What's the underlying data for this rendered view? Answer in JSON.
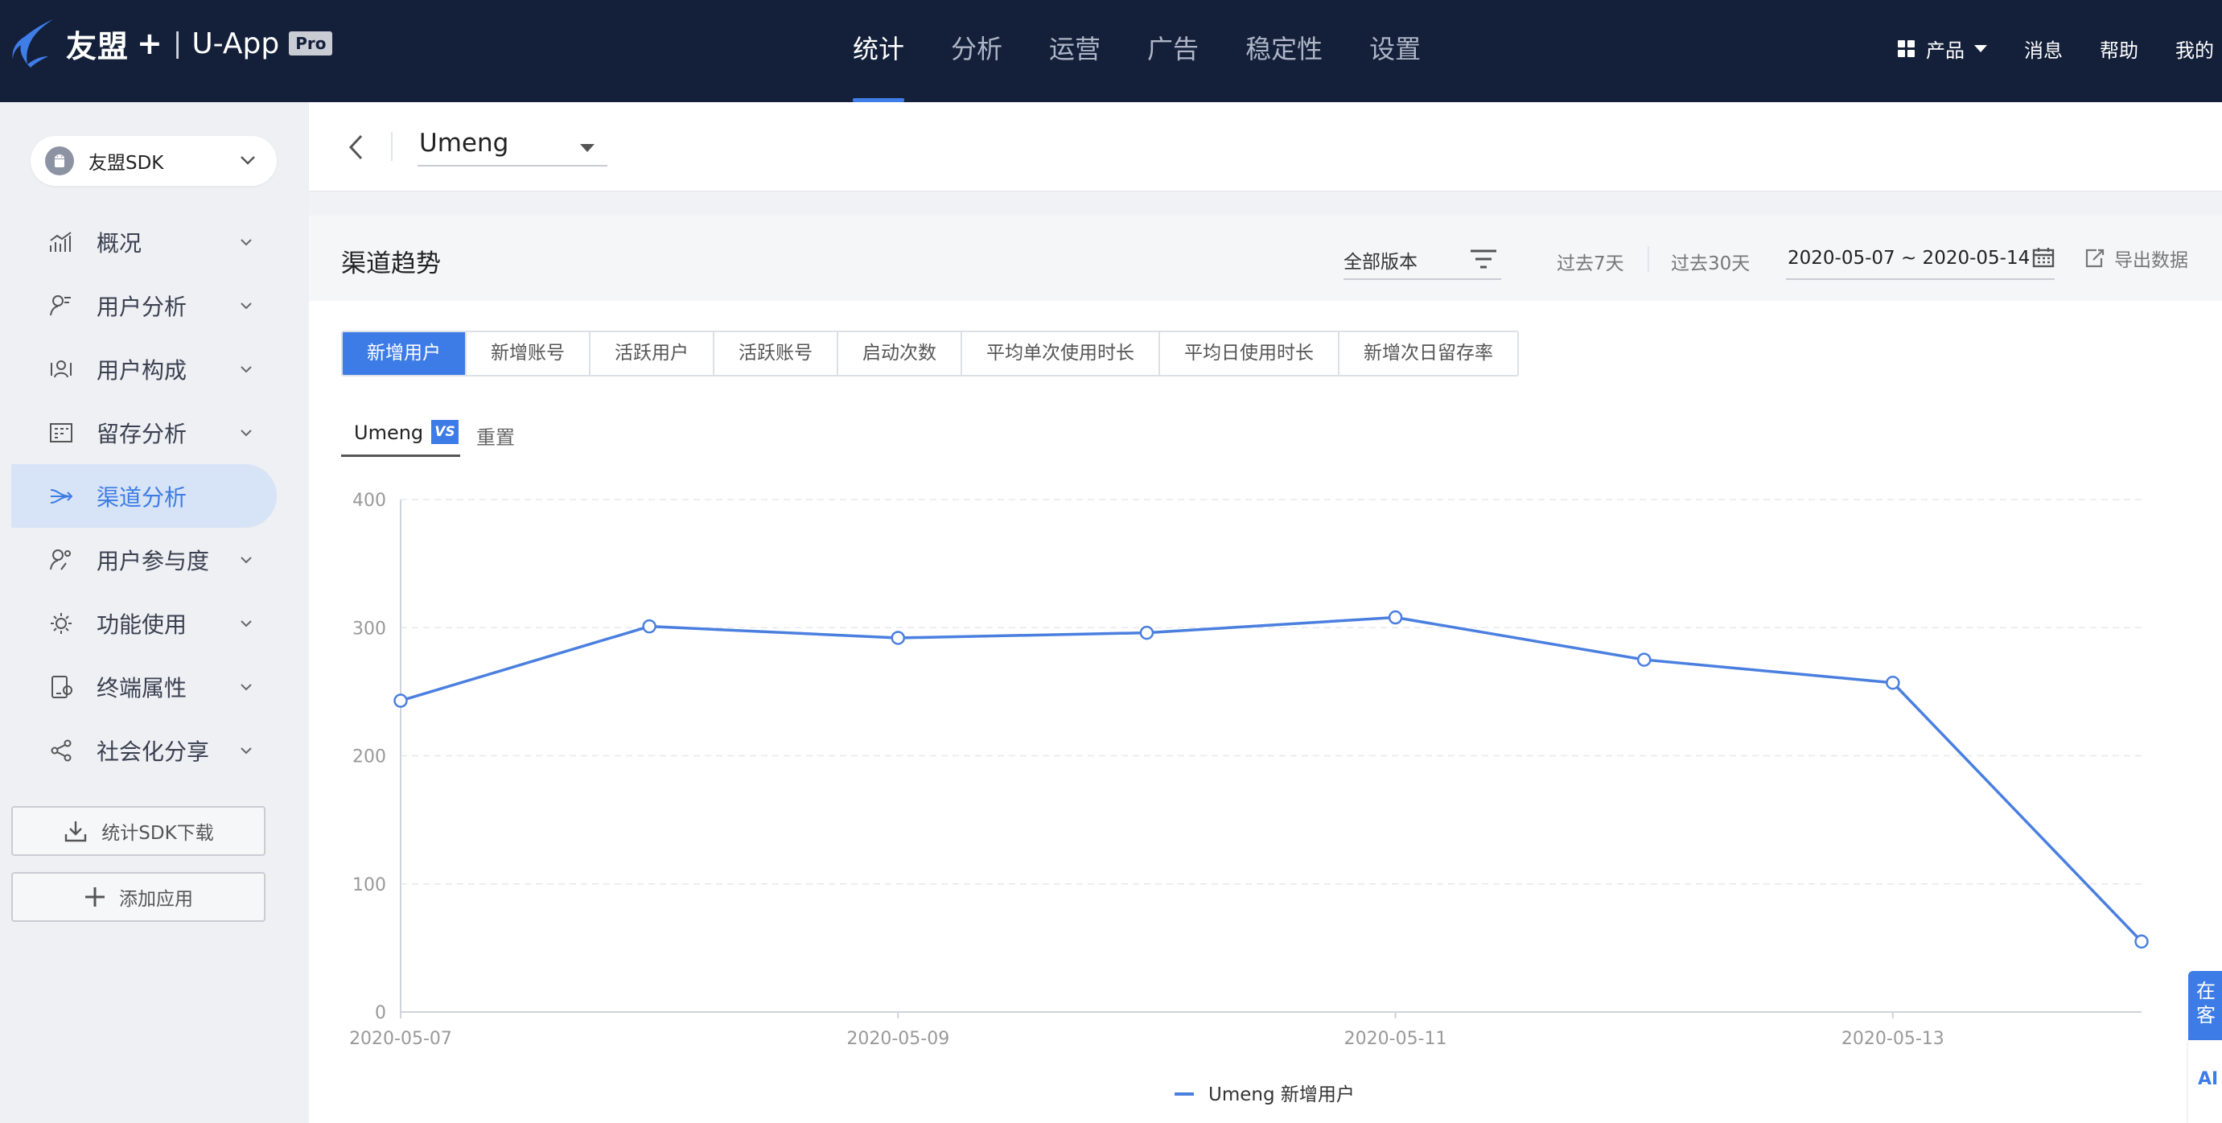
{
  "topbar": {
    "logo_text": "友盟",
    "logo_plus": "+",
    "logo_sep": "|",
    "logo_app": "U-App",
    "logo_badge": "Pro",
    "nav": [
      {
        "label": "统计",
        "active": true
      },
      {
        "label": "分析",
        "active": false
      },
      {
        "label": "运营",
        "active": false
      },
      {
        "label": "广告",
        "active": false
      },
      {
        "label": "稳定性",
        "active": false
      },
      {
        "label": "设置",
        "active": false
      }
    ],
    "right": {
      "product": "产品",
      "messages": "消息",
      "help": "帮助",
      "mine": "我的"
    }
  },
  "sidebar": {
    "app_name": "友盟SDK",
    "items": [
      {
        "label": "概况",
        "icon": "trend-icon"
      },
      {
        "label": "用户分析",
        "icon": "user-analysis-icon"
      },
      {
        "label": "用户构成",
        "icon": "user-composition-icon"
      },
      {
        "label": "留存分析",
        "icon": "retention-icon"
      },
      {
        "label": "渠道分析",
        "icon": "channel-icon",
        "active": true
      },
      {
        "label": "用户参与度",
        "icon": "engagement-icon"
      },
      {
        "label": "功能使用",
        "icon": "feature-icon"
      },
      {
        "label": "终端属性",
        "icon": "device-icon"
      },
      {
        "label": "社会化分享",
        "icon": "share-icon"
      }
    ],
    "download_label": "统计SDK下载",
    "add_app_label": "添加应用"
  },
  "subheader": {
    "channel": "Umeng"
  },
  "panel": {
    "title": "渠道趋势",
    "version_select": "全部版本",
    "last7": "过去7天",
    "last30": "过去30天",
    "date_range": "2020-05-07 ~ 2020-05-14",
    "export": "导出数据",
    "tabs": [
      {
        "label": "新增用户",
        "active": true
      },
      {
        "label": "新增账号"
      },
      {
        "label": "活跃用户"
      },
      {
        "label": "活跃账号"
      },
      {
        "label": "启动次数"
      },
      {
        "label": "平均单次使用时长"
      },
      {
        "label": "平均日使用时长"
      },
      {
        "label": "新增次日留存率"
      }
    ],
    "compare_channel": "Umeng",
    "vs_label": "VS",
    "reset": "重置"
  },
  "chart_data": {
    "type": "line",
    "x": [
      "2020-05-07",
      "2020-05-08",
      "2020-05-09",
      "2020-05-10",
      "2020-05-11",
      "2020-05-12",
      "2020-05-13",
      "2020-05-14"
    ],
    "x_tick_labels": [
      "2020-05-07",
      "2020-05-09",
      "2020-05-11",
      "2020-05-13"
    ],
    "series": [
      {
        "name": "Umeng 新增用户",
        "values": [
          243,
          301,
          292,
          296,
          308,
          275,
          257,
          55
        ],
        "color": "#4a7fe0"
      }
    ],
    "ylim": [
      0,
      400
    ],
    "y_ticks": [
      0,
      100,
      200,
      300,
      400
    ],
    "grid": true,
    "legend": "bottom-center"
  },
  "float_widget": {
    "top_text": "在客",
    "bottom_text": "AI"
  },
  "colors": {
    "navbar": "#14203a",
    "accent": "#3d7ce6",
    "line": "#4a7fe0"
  }
}
